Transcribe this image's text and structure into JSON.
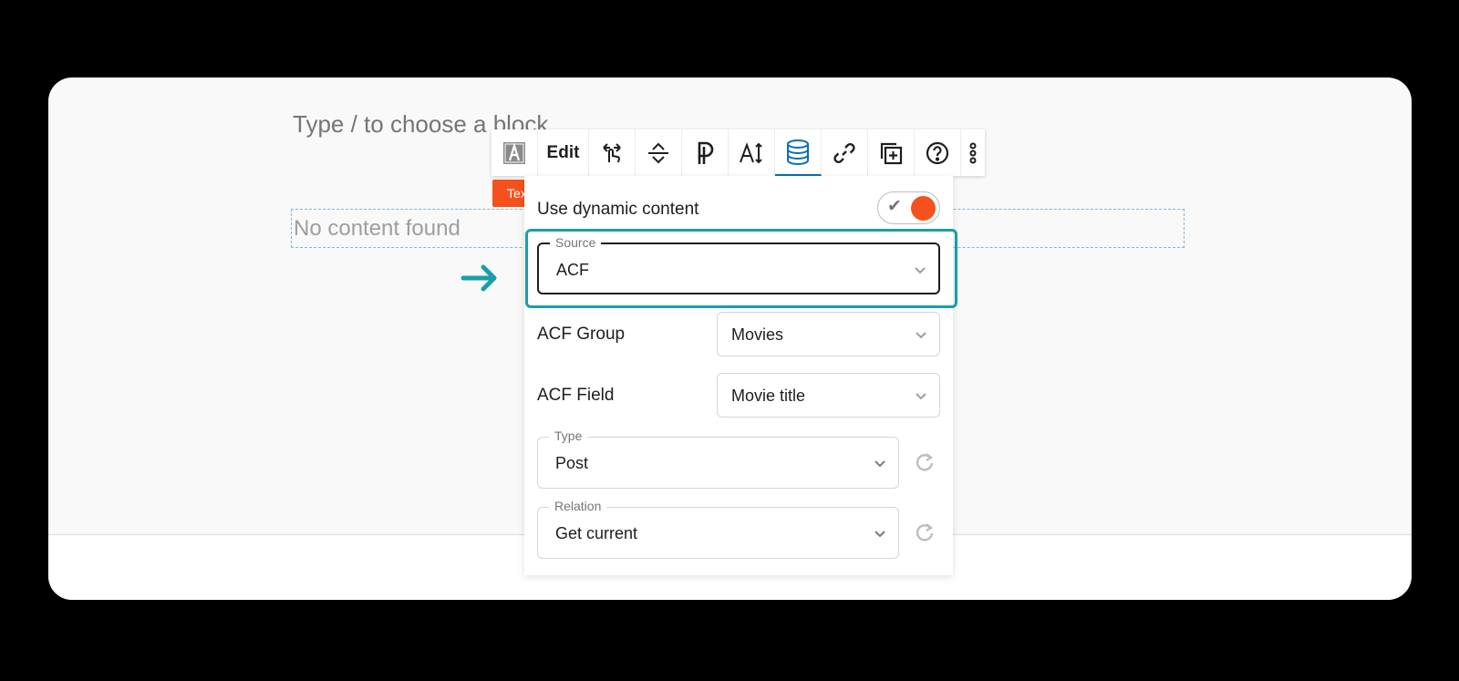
{
  "editor": {
    "placeholder": "Type / to choose a block",
    "no_content": "No content found",
    "block_tag": "Tex"
  },
  "toolbar": {
    "items": [
      {
        "icon": "text-block-icon"
      },
      {
        "label": "Edit"
      },
      {
        "icon": "pointer-gesture-icon"
      },
      {
        "icon": "align-vertical-icon"
      },
      {
        "icon": "paragraph-icon"
      },
      {
        "icon": "text-size-icon"
      },
      {
        "icon": "database-icon",
        "active": true
      },
      {
        "icon": "link-icon"
      },
      {
        "icon": "add-block-icon"
      },
      {
        "icon": "help-icon"
      },
      {
        "icon": "more-vertical-icon"
      }
    ],
    "accent_color": "#0a6fb3"
  },
  "panel": {
    "dynamic_label": "Use dynamic content",
    "toggle_on": true,
    "source": {
      "legend": "Source",
      "value": "ACF"
    },
    "acf_group": {
      "label": "ACF Group",
      "value": "Movies"
    },
    "acf_field": {
      "label": "ACF Field",
      "value": "Movie title"
    },
    "type": {
      "legend": "Type",
      "value": "Post"
    },
    "relation": {
      "legend": "Relation",
      "value": "Get current"
    }
  },
  "colors": {
    "highlight": "#1a9ea8",
    "toggle_knob": "#f4511e"
  }
}
